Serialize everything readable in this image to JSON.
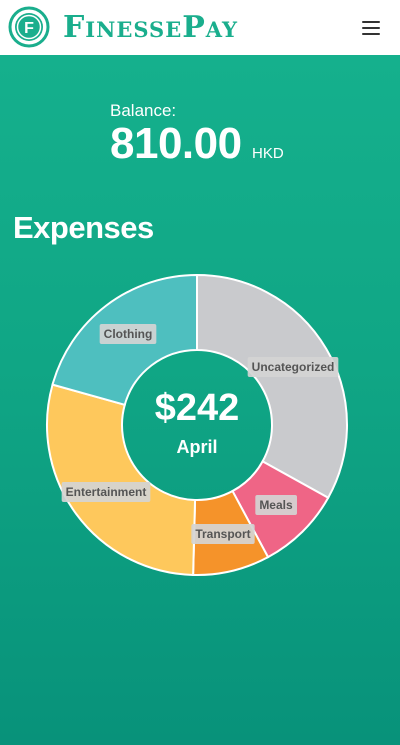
{
  "app": {
    "brand": "FinessePay",
    "logo_letter": "F",
    "brand_color": "#1aae8d",
    "logo_icon": "finessepay-logo-icon",
    "menu_icon": "hamburger-menu-icon"
  },
  "balance": {
    "label": "Balance:",
    "amount": "810.00",
    "currency": "HKD"
  },
  "expenses": {
    "title": "Expenses",
    "center_amount": "$242",
    "center_period": "April"
  },
  "chart_data": {
    "type": "doughnut",
    "title": "",
    "series": [
      {
        "label": "Uncategorized",
        "value": 80,
        "color": "#c9cacd"
      },
      {
        "label": "Meals",
        "value": 22,
        "color": "#ef6586"
      },
      {
        "label": "Transport",
        "value": 20,
        "color": "#f5932a"
      },
      {
        "label": "Entertainment",
        "value": 70,
        "color": "#fec85c"
      },
      {
        "label": "Clothing",
        "value": 50,
        "color": "#4ebfbf"
      }
    ],
    "total": 242,
    "legend": "labels-on-slices"
  },
  "colors": {
    "main_background": "#12ab89",
    "slice_border": "#ffffff",
    "label_background": "#d4d4d4",
    "label_text": "#555555"
  }
}
